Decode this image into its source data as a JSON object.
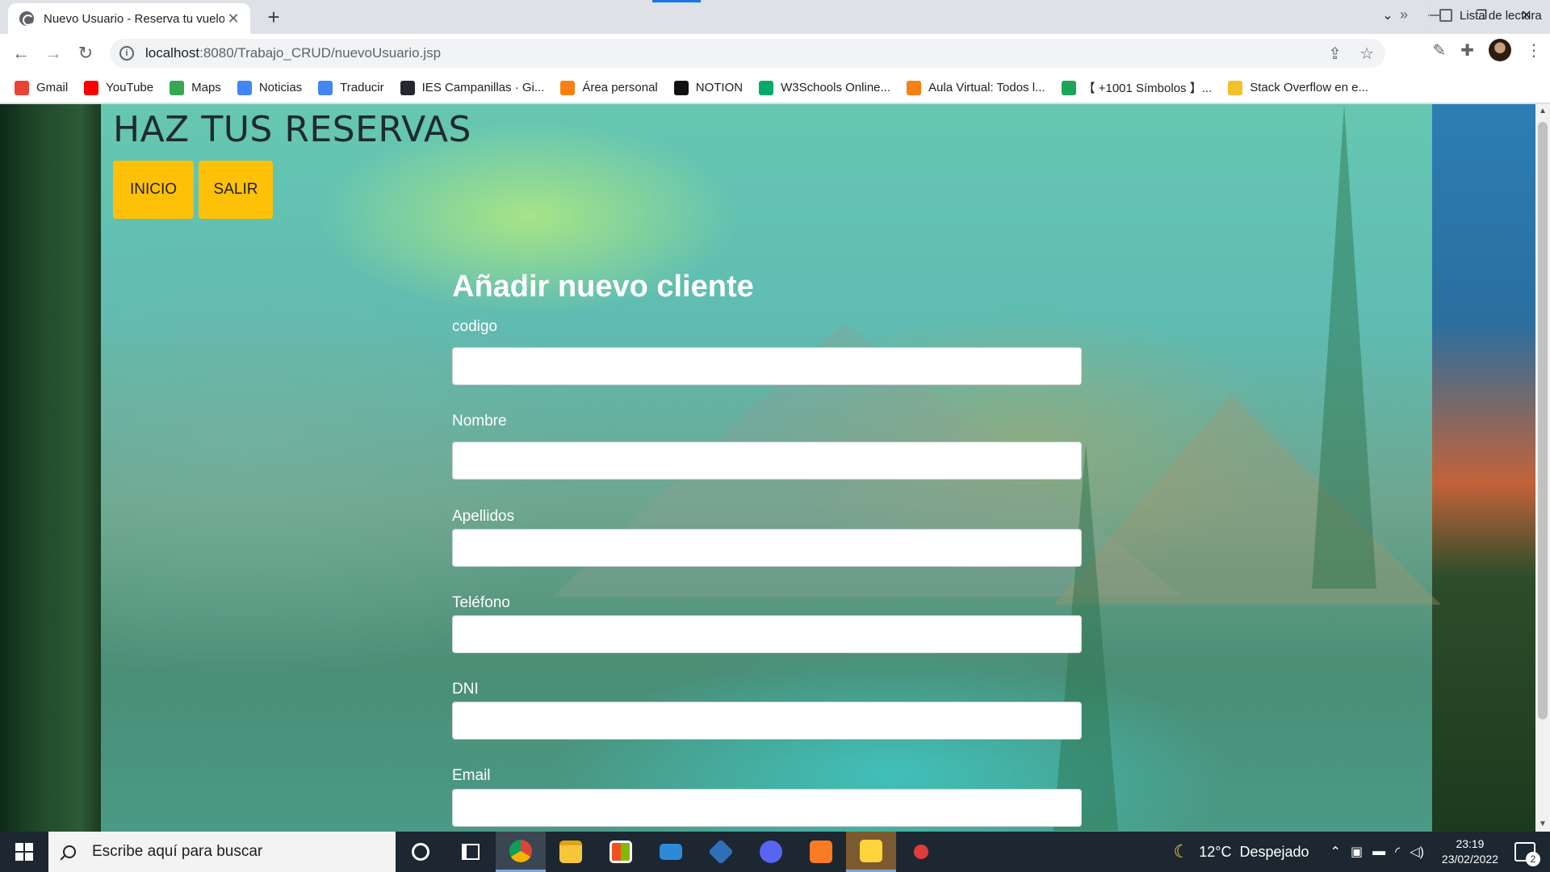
{
  "browser": {
    "tab_title": "Nuevo Usuario - Reserva tu vuelo",
    "url_host": "localhost",
    "url_rest": ":8080/Trabajo_CRUD/nuevoUsuario.jsp",
    "bookmarks": [
      {
        "label": "Gmail",
        "icon": "gmail-icon",
        "color": "#ea4335"
      },
      {
        "label": "YouTube",
        "icon": "youtube-icon",
        "color": "#ff0000"
      },
      {
        "label": "Maps",
        "icon": "maps-icon",
        "color": "#34a853"
      },
      {
        "label": "Noticias",
        "icon": "news-icon",
        "color": "#4285f4"
      },
      {
        "label": "Traducir",
        "icon": "translate-icon",
        "color": "#4285f4"
      },
      {
        "label": "IES Campanillas · Gi...",
        "icon": "github-icon",
        "color": "#24292e"
      },
      {
        "label": "Área personal",
        "icon": "moodle-icon",
        "color": "#f98012"
      },
      {
        "label": "NOTION",
        "icon": "notion-icon",
        "color": "#111111"
      },
      {
        "label": "W3Schools Online...",
        "icon": "w3schools-icon",
        "color": "#04aa6d"
      },
      {
        "label": "Aula Virtual: Todos l...",
        "icon": "moodle-icon",
        "color": "#f98012"
      },
      {
        "label": "【 +1001 Símbolos 】...",
        "icon": "symbols-icon",
        "color": "#1ba55a"
      },
      {
        "label": "Stack Overflow en e...",
        "icon": "stackoverflow-icon",
        "color": "#f2c029"
      }
    ],
    "bookmarks_more": "»",
    "reading_list": "Lista de lectura"
  },
  "page": {
    "heading": "HAZ TUS RESERVAS",
    "nav": {
      "home": "INICIO",
      "exit": "SALIR"
    },
    "form": {
      "title": "Añadir nuevo cliente",
      "fields": [
        {
          "label": "codigo",
          "value": ""
        },
        {
          "label": "Nombre",
          "value": ""
        },
        {
          "label": "Apellidos",
          "value": ""
        },
        {
          "label": "Teléfono",
          "value": ""
        },
        {
          "label": "DNI",
          "value": ""
        },
        {
          "label": "Email",
          "value": ""
        }
      ]
    },
    "colors": {
      "button": "#ffc107",
      "label": "#ffffff"
    }
  },
  "taskbar": {
    "search_placeholder": "Escribe aquí para buscar",
    "apps": [
      {
        "name": "cortana-icon"
      },
      {
        "name": "task-view-icon"
      },
      {
        "name": "chrome-icon",
        "color": "#db4437"
      },
      {
        "name": "file-explorer-icon",
        "color": "#f8c63a"
      },
      {
        "name": "microsoft-store-icon",
        "color": "#ffffff"
      },
      {
        "name": "mail-icon",
        "color": "#2c8ad8"
      },
      {
        "name": "virtualbox-icon",
        "color": "#2f6fb8"
      },
      {
        "name": "discord-icon",
        "color": "#5865f2"
      },
      {
        "name": "xampp-icon",
        "color": "#fb7a24"
      },
      {
        "name": "sticky-app-icon",
        "color": "#ffd33c"
      },
      {
        "name": "snipping-tool-icon",
        "color": "#e23b3b"
      }
    ],
    "weather_temp": "12°C",
    "weather_text": "Despejado",
    "time": "23:19",
    "date": "23/02/2022",
    "notifications": "2"
  }
}
